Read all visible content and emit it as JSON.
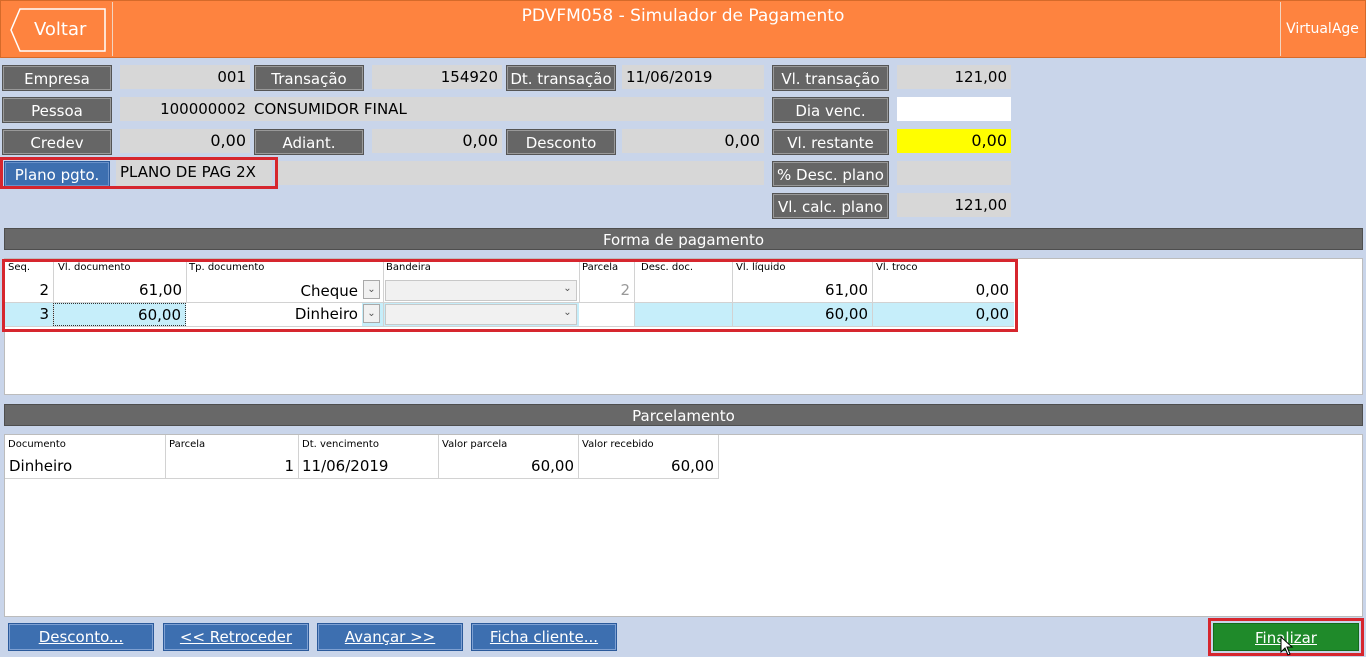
{
  "header": {
    "back_label": "Voltar",
    "title": "PDVFM058 - Simulador de Pagamento",
    "right_label": "VirtualAge"
  },
  "form": {
    "empresa_label": "Empresa",
    "empresa_value": "001",
    "transacao_label": "Transação",
    "transacao_value": "154920",
    "dt_transacao_label": "Dt. transação",
    "dt_transacao_value": "11/06/2019",
    "vl_transacao_label": "Vl. transação",
    "vl_transacao_value": "121,00",
    "pessoa_label": "Pessoa",
    "pessoa_code": "100000002",
    "pessoa_name": "CONSUMIDOR FINAL",
    "dia_venc_label": "Dia venc.",
    "dia_venc_value": "",
    "credev_label": "Credev",
    "credev_value": "0,00",
    "adiant_label": "Adiant.",
    "adiant_value": "0,00",
    "desconto_label": "Desconto",
    "desconto_value": "0,00",
    "vl_restante_label": "Vl. restante",
    "vl_restante_value": "0,00",
    "plano_label": "Plano pgto.",
    "plano_value": "PLANO DE PAG 2X",
    "desc_plano_label": "% Desc. plano",
    "desc_plano_value": "",
    "vl_calc_plano_label": "Vl. calc. plano",
    "vl_calc_plano_value": "121,00"
  },
  "payment": {
    "title": "Forma de pagamento",
    "columns": [
      "Seq.",
      "Vl. documento",
      "Tp. documento",
      "Bandeira",
      "Parcela",
      "Desc. doc.",
      "Vl. líquido",
      "Vl. troco"
    ],
    "rows": [
      {
        "seq": "2",
        "vl_documento": "61,00",
        "tp_documento": "Cheque",
        "bandeira": "",
        "parcela": "2",
        "desc_doc": "",
        "vl_liquido": "61,00",
        "vl_troco": "0,00"
      },
      {
        "seq": "3",
        "vl_documento": "60,00",
        "tp_documento": "Dinheiro",
        "bandeira": "",
        "parcela": "",
        "desc_doc": "",
        "vl_liquido": "60,00",
        "vl_troco": "0,00"
      }
    ]
  },
  "installments": {
    "title": "Parcelamento",
    "columns": [
      "Documento",
      "Parcela",
      "Dt. vencimento",
      "Valor parcela",
      "Valor recebido"
    ],
    "rows": [
      {
        "documento": "Dinheiro",
        "parcela": "1",
        "dt_vencimento": "11/06/2019",
        "valor_parcela": "60,00",
        "valor_recebido": "60,00"
      }
    ]
  },
  "footer": {
    "desconto_btn": "Desconto...",
    "retroceder_btn": "<< Retroceder",
    "avancar_btn": "Avançar >>",
    "ficha_btn": "Ficha cliente...",
    "finalizar_btn": "Finalizar"
  },
  "colors": {
    "header": "#fe833f",
    "background": "#c9d5ea",
    "label_gray": "#666666",
    "label_blue": "#3d6fb0",
    "highlight_yellow": "#fffe00",
    "selected_row": "#c6eefa",
    "finalize_green": "#1f8a2a",
    "annotation_red": "#d6262e"
  }
}
